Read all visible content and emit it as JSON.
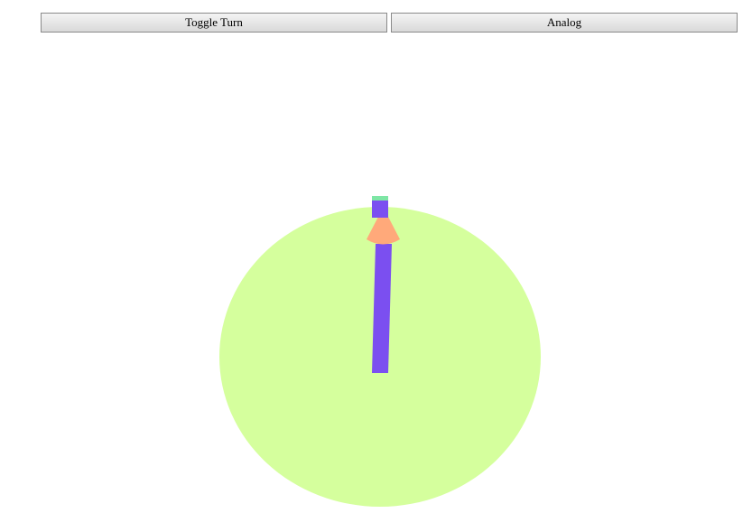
{
  "toolbar": {
    "toggle_label": "Toggle Turn",
    "mode_label": "Analog"
  },
  "colors": {
    "dial_face": "#d5ff9d",
    "hand": "#7b4ff0",
    "cone": "#ffa97a",
    "cap": "#7ee6a5"
  }
}
